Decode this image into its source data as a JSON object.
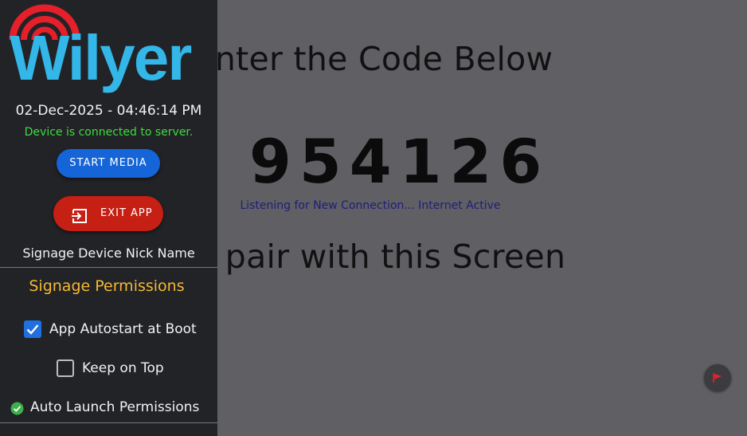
{
  "main": {
    "heading_top": "Enter the Code Below",
    "code": "954126",
    "status": "Listening for New Connection... Internet Active",
    "heading_bottom": "to pair with this Screen"
  },
  "sidebar": {
    "logo_text": "Wilyer",
    "datetime": "02-Dec-2025 - 04:46:14 PM",
    "connection_status": "Device is connected to server.",
    "start_button": "START MEDIA",
    "exit_button": "EXIT APP",
    "nick_name_label": "Signage Device Nick Name",
    "permissions_title": "Signage Permissions",
    "permissions": [
      {
        "label": "App Autostart at Boot",
        "checked": true
      },
      {
        "label": "Keep on Top",
        "checked": false
      }
    ],
    "auto_launch_label": "Auto Launch Permissions"
  },
  "colors": {
    "accent_blue": "#1565d8",
    "exit_red": "#c62015",
    "logo_blue": "#33b6e8",
    "logo_red": "#e5202a",
    "permissions_gold": "#f5b833",
    "connected_green": "#3ddc3d",
    "background_gray": "#5f5f64",
    "sidebar_dark": "#222327"
  },
  "icons": {
    "exit": "exit-icon",
    "check": "check-icon",
    "auto_launch": "check-circle-icon",
    "floating": "flag-icon",
    "logo_signal": "wifi-signal-icon"
  }
}
